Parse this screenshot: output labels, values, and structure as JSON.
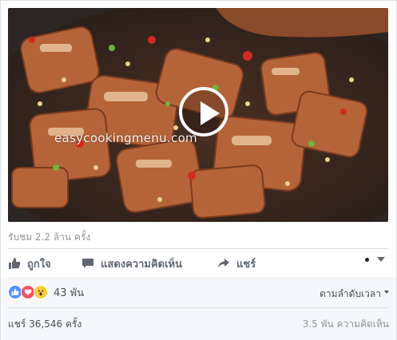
{
  "video": {
    "watermark": "easycookingmenu.com"
  },
  "stats": {
    "views": "รับชม 2.2 ล้าน ครั้ง"
  },
  "actions": {
    "like_label": "ถูกใจ",
    "comment_label": "แสดงความคิดเห็น",
    "share_label": "แชร์"
  },
  "reactions": {
    "icons": [
      "like-icon",
      "love-icon",
      "wow-icon"
    ],
    "count": "43 พัน"
  },
  "sort": {
    "label": "ตามลำดับเวลา"
  },
  "footer": {
    "shares": "แชร์ 36,546 ครั้ง",
    "comments": "3.5 พัน ความคิดเห็น"
  },
  "colors": {
    "like": "#5890ff",
    "love": "#f25268",
    "wow": "#fbcd3c",
    "text_muted": "#90949c",
    "action_text": "#606770"
  }
}
